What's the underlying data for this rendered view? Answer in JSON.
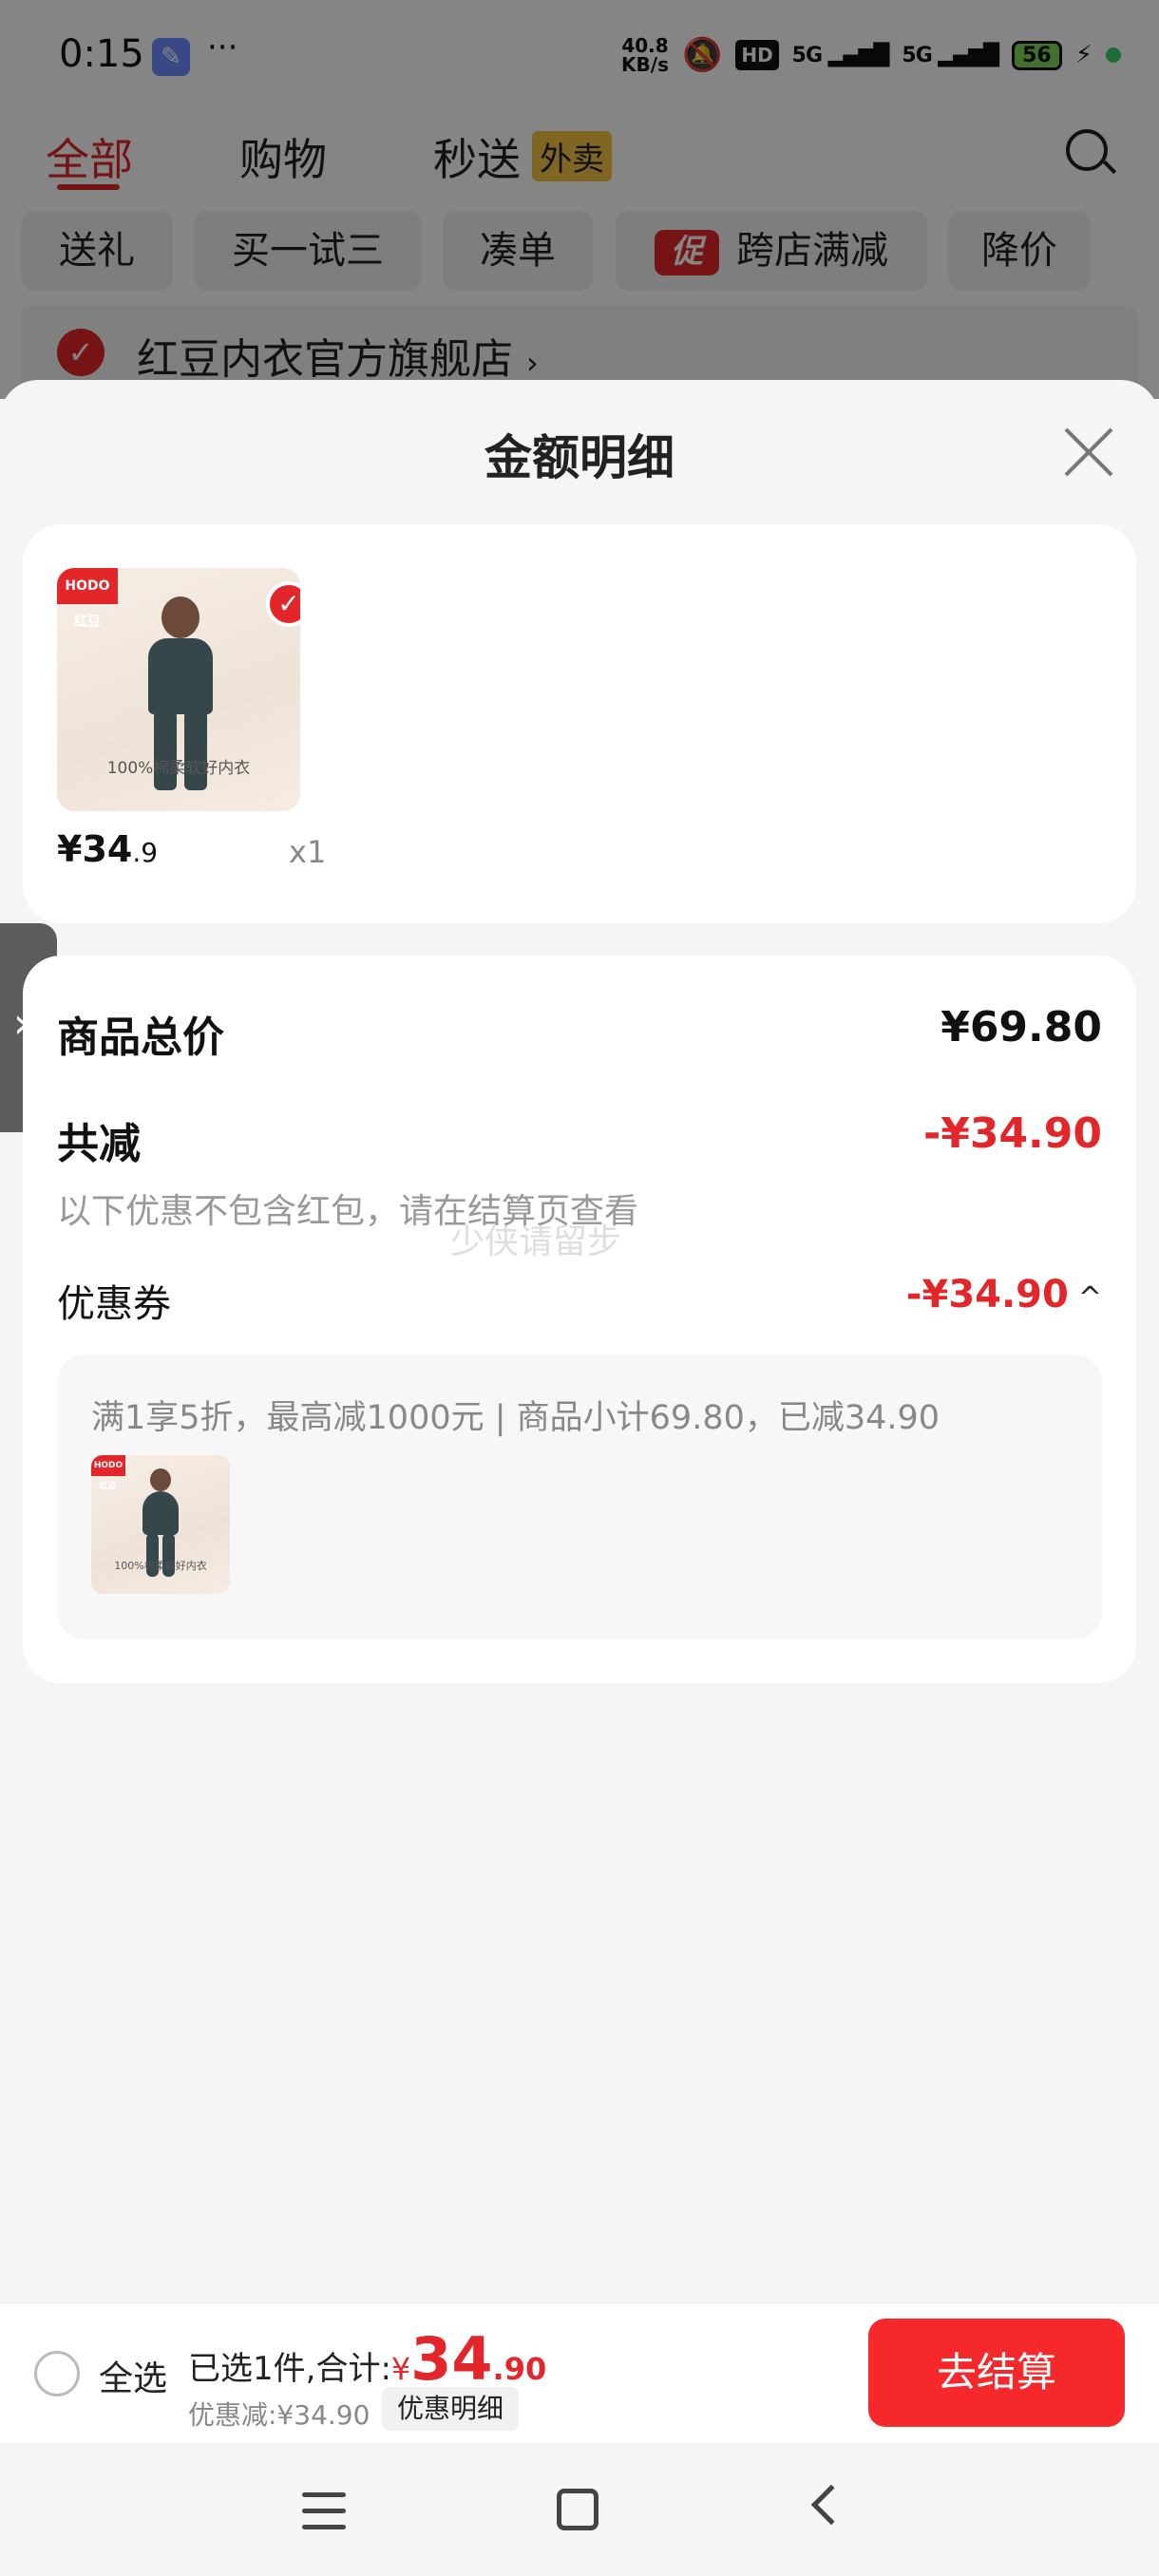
{
  "status_bar": {
    "time": "0:15",
    "dots": "···",
    "speed": "40.8",
    "speed_unit": "KB/s",
    "hd": "HD",
    "net1": "5G",
    "net2": "5G",
    "battery": "56"
  },
  "top_tabs": {
    "all": "全部",
    "shopping": "购物",
    "fast": "秒送",
    "fast_badge": "外卖"
  },
  "filter_chips": [
    "送礼",
    "买一试三",
    "凑单",
    "跨店满减",
    "降价"
  ],
  "promo_tag": "促",
  "store": {
    "name": "红豆内衣官方旗舰店",
    "chevron": "›"
  },
  "sheet": {
    "title": "金额明细",
    "product": {
      "logo": "HODO 红豆",
      "caption": "100%棉柔软好内衣",
      "price_main": "¥34",
      "price_decimal": ".9",
      "qty": "x1"
    },
    "total_label": "商品总价",
    "total_value": "¥69.80",
    "reduce_label": "共减",
    "reduce_value": "-¥34.90",
    "hint": "以下优惠不包含红包，请在结算页查看",
    "watermark": "少侠请留步",
    "coupon_label": "优惠券",
    "coupon_value": "-¥34.90",
    "coupon_caret": "^",
    "coupon_desc": "满1享5折，最高减1000元 | 商品小计69.80，已减34.90",
    "coupon_img_caption": "100%棉柔软好内衣"
  },
  "bottom_bar": {
    "select_all": "全选",
    "selected_prefix": "已选1件,合计:",
    "yen": "¥",
    "total_int": "34",
    "total_dec": ".90",
    "discount": "优惠减:¥34.90",
    "detail_button": "优惠明细",
    "checkout": "去结算"
  },
  "colors": {
    "accent": "#e3262a",
    "checkout": "#f5282b",
    "sheet_bg": "#f5f5f5"
  }
}
